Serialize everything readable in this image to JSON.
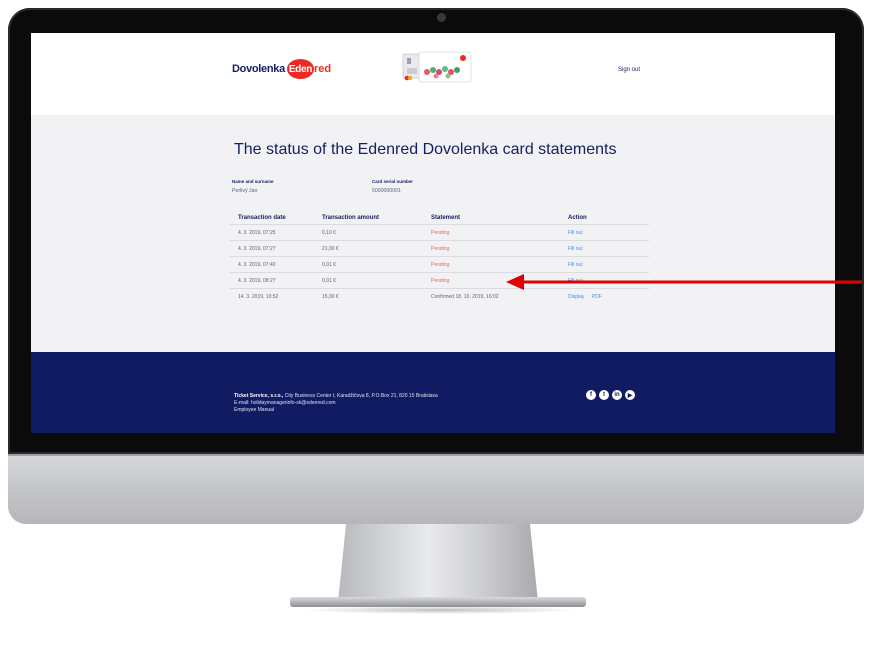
{
  "header": {
    "logo_text": "Dovolenka",
    "logo_badge": "Eden",
    "logo_red": "red",
    "signout_label": "Sign out",
    "card_image_icon": "card-image"
  },
  "page": {
    "title": "The status of the Edenred Dovolenka card statements"
  },
  "holder": {
    "name_label": "Name and surname",
    "name_value": "Perlivý Jan",
    "serial_label": "Card serial number",
    "serial_value": "5000000001"
  },
  "table": {
    "headers": [
      "Transaction date",
      "Transaction amount",
      "Statement",
      "Action"
    ],
    "rows": [
      {
        "date": "4. 3. 2019, 07:25",
        "amount": "0,10 €",
        "statement": "Pending",
        "action": "Fill out",
        "action2": ""
      },
      {
        "date": "4. 3. 2019, 07:27",
        "amount": "21,00 €",
        "statement": "Pending",
        "action": "Fill out",
        "action2": ""
      },
      {
        "date": "4. 3. 2019, 07:40",
        "amount": "0,01 €",
        "statement": "Pending",
        "action": "Fill out",
        "action2": ""
      },
      {
        "date": "4. 3. 2019, 08:27",
        "amount": "0,01 €",
        "statement": "Pending",
        "action": "Fill out",
        "action2": ""
      },
      {
        "date": "14. 3. 2019, 10:52",
        "amount": "15,00 €",
        "statement": "Confirmed 18. 10. 2019, 16:02",
        "action": "Display",
        "action2": "PDF"
      }
    ]
  },
  "footer": {
    "company": "Ticket Service, s.r.o.,",
    "address": " City Business Center I, Karadžičova 8, P.O.Box 21, 820 15 Bratislava",
    "email": "E-mail: holidaymanagerinfo-sk@edenred.com",
    "manual": "Employee Manual",
    "social": [
      {
        "icon": "facebook-icon",
        "glyph": "f"
      },
      {
        "icon": "twitter-icon",
        "glyph": "t"
      },
      {
        "icon": "linkedin-icon",
        "glyph": "in"
      },
      {
        "icon": "youtube-icon",
        "glyph": "▶"
      }
    ]
  },
  "colors": {
    "navy": "#162163",
    "footer": "#111b62",
    "pending": "#e56757",
    "link": "#4a8fe0",
    "brand_red": "#ee2a24",
    "annotation_arrow": "#e00000"
  }
}
